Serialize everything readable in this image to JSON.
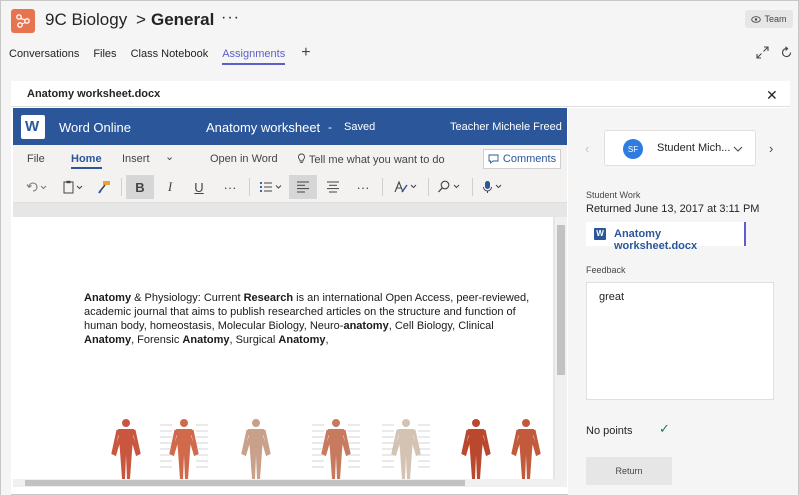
{
  "header": {
    "team_name": "9C Biology",
    "separator": ">",
    "channel": "General",
    "more": "···",
    "team_button": "Team"
  },
  "tabs": [
    {
      "label": "Conversations"
    },
    {
      "label": "Files"
    },
    {
      "label": "Class Notebook"
    },
    {
      "label": "Assignments"
    }
  ],
  "tab_add": "+",
  "panel": {
    "title": "Anatomy worksheet.docx",
    "close": "✕"
  },
  "word": {
    "logo_letter": "W",
    "app_name": "Word Online",
    "doc_title": "Anatomy worksheet",
    "dash": "-",
    "status": "Saved",
    "user": "Teacher Michele Freed"
  },
  "ribbon": {
    "tab_file": "File",
    "tab_home": "Home",
    "tab_insert": "Insert",
    "tab_more": "⌄",
    "open_in_word": "Open in Word",
    "tell_me": "Tell me what you want to do",
    "comments": "Comments",
    "bold": "B",
    "italic": "I",
    "underline": "U",
    "ellipsis": "···"
  },
  "doc": {
    "paragraph": [
      {
        "t": "Anatomy",
        "b": true
      },
      {
        "t": " & Physiology: Current ",
        "b": false
      },
      {
        "t": "Research",
        "b": true
      },
      {
        "t": " is an international Open Access, peer-reviewed, academic journal that aims to publish researched articles on the structure and function of human body, homeostasis, Molecular Biology, Neuro-",
        "b": false
      },
      {
        "t": "anatomy",
        "b": true
      },
      {
        "t": ", Cell Biology, Clinical ",
        "b": false
      },
      {
        "t": "Anatomy",
        "b": true
      },
      {
        "t": ", Forensic ",
        "b": false
      },
      {
        "t": "Anatomy",
        "b": true
      },
      {
        "t": ", Surgical ",
        "b": false
      },
      {
        "t": "Anatomy",
        "b": true
      },
      {
        "t": ",",
        "b": false
      }
    ]
  },
  "right_pane": {
    "student_initials": "SF",
    "student_name": "Student Mich...",
    "student_work_label": "Student Work",
    "returned_text": "Returned June 13, 2017 at 3:11 PM",
    "file_name": "Anatomy worksheet.docx",
    "feedback_label": "Feedback",
    "feedback_text": "great",
    "points_text": "No points",
    "return_button": "Return"
  },
  "colors": {
    "word_blue": "#2b579a",
    "teams_purple": "#5b5fc7",
    "team_logo": "#e8744f",
    "check_green": "#237b4b"
  },
  "icons": [
    "team-logo-icon",
    "eye-icon",
    "expand-icon",
    "refresh-icon",
    "close-icon",
    "word-logo-icon",
    "undo-icon",
    "paste-icon",
    "format-painter-icon",
    "bullets-icon",
    "align-left-icon",
    "align-center-icon",
    "styles-icon",
    "find-icon",
    "dictate-icon",
    "lightbulb-icon",
    "comment-icon",
    "chevron-left-icon",
    "chevron-right-icon",
    "check-icon"
  ]
}
